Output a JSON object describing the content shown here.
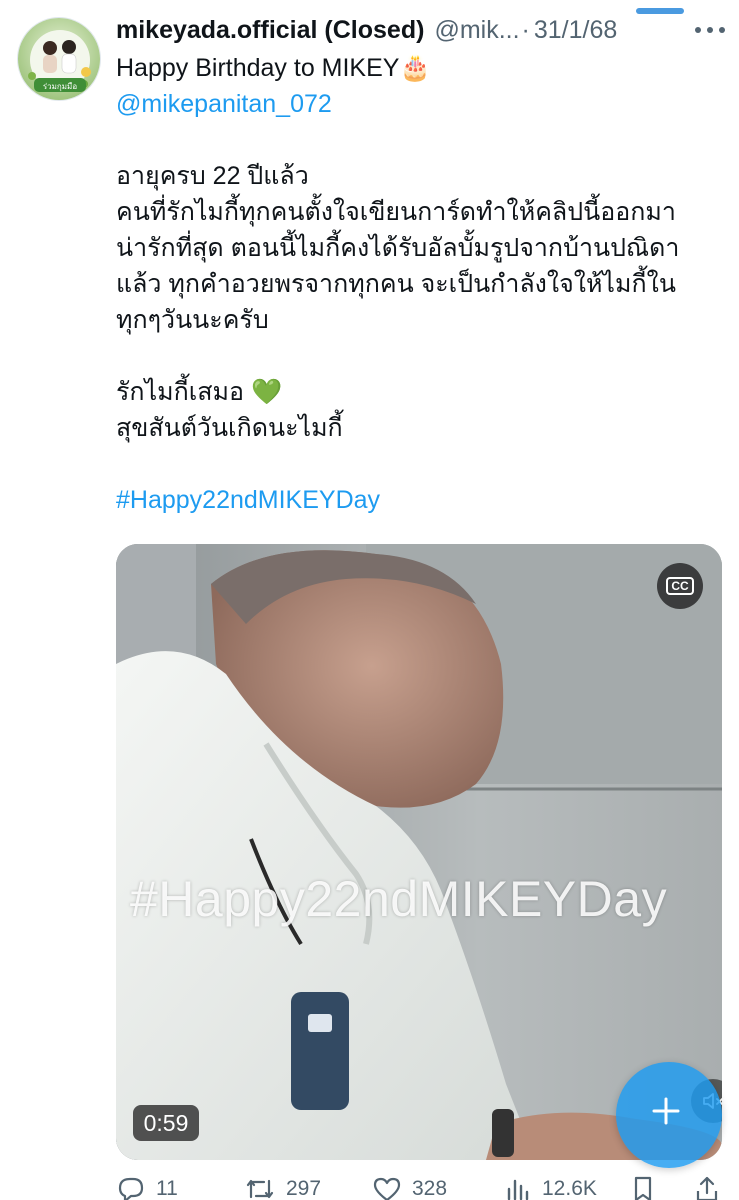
{
  "tweet": {
    "display_name": "mikeyada.official (Closed)",
    "handle": "@mik...",
    "separator": "·",
    "time": "31/1/68",
    "lines": [
      "Happy Birthday to MIKEY🎂",
      "@mikepanitan_072",
      "",
      "อายุครบ 22 ปีแล้ว",
      "คนที่รักไมกี้ทุกคนตั้งใจเขียนการ์ดทำให้คลิปนี้ออกมา",
      "น่ารักที่สุด ตอนนี้ไมกี้คงได้รับอัลบั้มรูปจากบ้านปณิดา",
      "แล้ว ทุกคำอวยพรจากทุกคน จะเป็นกำลังใจให้ไมกี้ใน",
      "ทุกๆวันนะครับ",
      "",
      "รักไมกี้เสมอ 💚",
      "สุขสันต์วันเกิดนะไมกี้",
      "",
      "#Happy22ndMIKEYDay"
    ]
  },
  "avatar": {
    "caption": "ร่วมกุมมือ"
  },
  "media": {
    "overlay_text": "#Happy22ndMIKEYDay",
    "duration": "0:59",
    "cc_label": "CC"
  },
  "actions": {
    "replies": "11",
    "retweets": "297",
    "likes": "328",
    "views": "12.6K"
  },
  "colors": {
    "link": "#1d9bf0",
    "secondary_text": "#536471",
    "fab": "#1d9bf0"
  },
  "icons": [
    "more-icon",
    "cc-icon",
    "mute-icon",
    "reply-icon",
    "retweet-icon",
    "like-icon",
    "views-icon",
    "bookmark-icon",
    "share-icon",
    "compose-plus-icon"
  ]
}
